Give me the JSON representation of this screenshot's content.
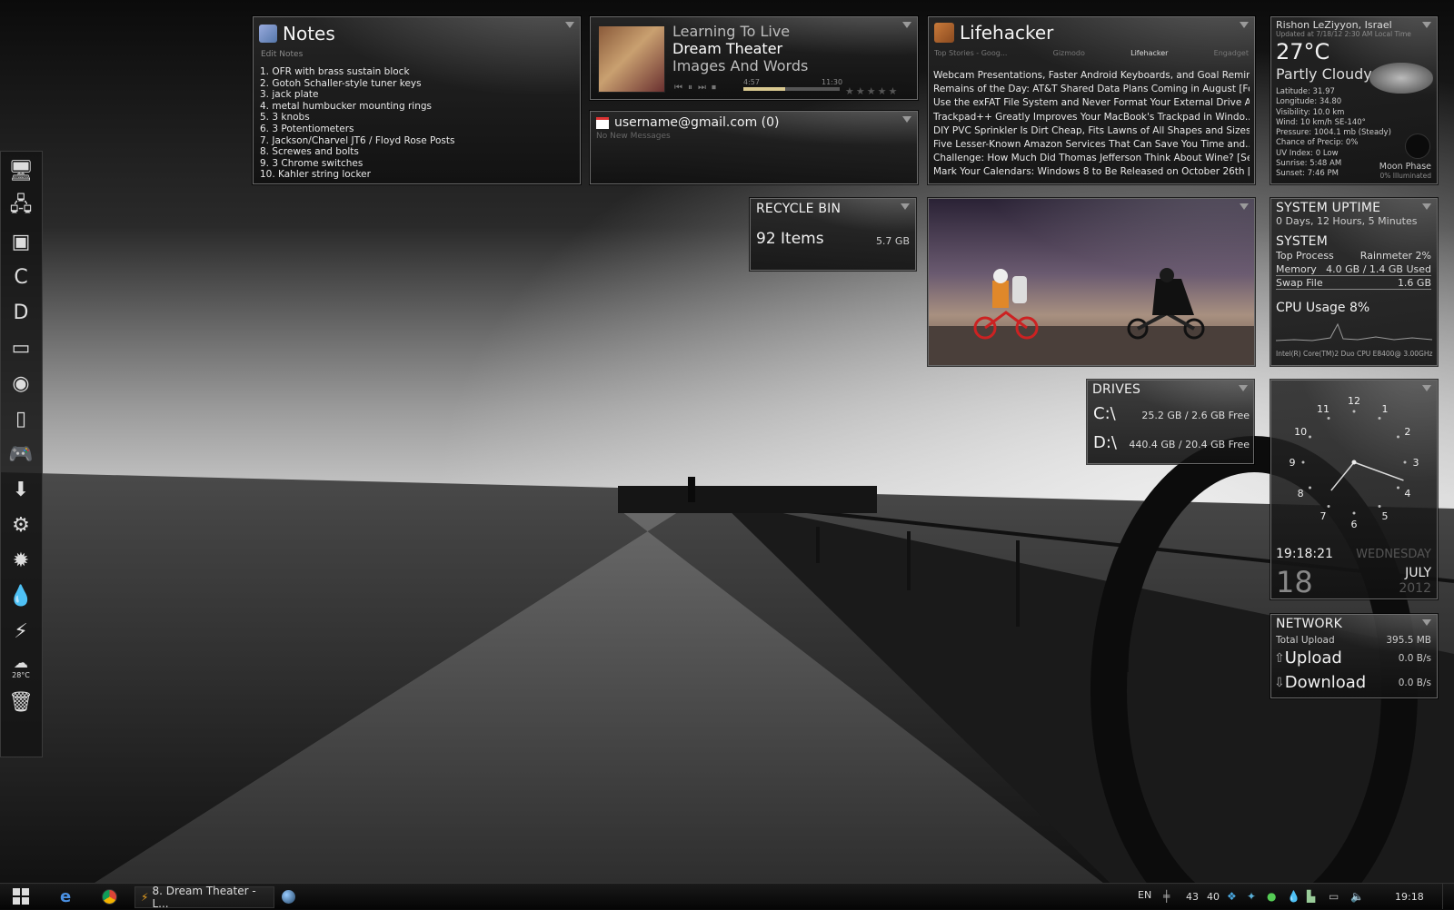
{
  "notes": {
    "title": "Notes",
    "subtitle": "Edit Notes",
    "items": [
      "1. OFR with brass sustain block",
      "2. Gotoh Schaller-style tuner keys",
      "3. jack plate",
      "4. metal humbucker mounting rings",
      "5. 3 knobs",
      "6. 3 Potentiometers",
      "7. Jackson/Charvel JT6 / Floyd Rose Posts",
      "8. Screwes and bolts",
      "9. 3 Chrome switches",
      "10. Kahler string locker"
    ]
  },
  "player": {
    "track": "Learning To Live",
    "artist": "Dream Theater",
    "album": "Images And Words",
    "elapsed": "4:57",
    "total": "11:30",
    "progress": 0.43
  },
  "gmail": {
    "account": "username@gmail.com (0)",
    "status": "No New Messages"
  },
  "recycle": {
    "title": "RECYCLE BIN",
    "items": "92 Items",
    "size": "5.7 GB"
  },
  "lifehacker": {
    "title": "Lifehacker",
    "tabs": [
      "Top Stories - Goog...",
      "Gizmodo",
      "Lifehacker",
      "Engadget"
    ],
    "headlines": [
      "Webcam Presentations, Faster Android Keyboards, and Goal Remin...",
      "Remains of the Day: AT&T Shared Data Plans Coming in August [For...",
      "Use the exFAT File System and Never Format Your External Drive Ag...",
      "Trackpad++ Greatly Improves Your MacBook's Trackpad in Windo...",
      "DIY PVC Sprinkler Is Dirt Cheap, Fits Lawns of All Shapes and Sizes...",
      "Five Lesser-Known Amazon Services That Can Save You Time and...",
      "Challenge: How Much Did Thomas Jefferson Think About Wine? [Se...",
      "Mark Your Calendars: Windows 8 to Be Released on October 26th [I..."
    ]
  },
  "weather": {
    "location": "Rishon LeZiyyon, Israel",
    "updated": "Updated at 7/18/12 2:30 AM Local Time",
    "temp": "27°C",
    "condition": "Partly Cloudy",
    "details": [
      "Latitude: 31.97",
      "Longitude: 34.80",
      "Visibility: 10.0 km",
      "Wind: 10 km/h SE-140°",
      "Pressure: 1004.1 mb (Steady)",
      "Chance of Precip: 0%",
      "UV Index: 0 Low",
      "Sunrise: 5:48 AM",
      "Sunset: 7:46 PM"
    ],
    "moon_label": "Moon Phase",
    "moon_value": "0% Illuminated"
  },
  "system": {
    "uptime_title": "SYSTEM UPTIME",
    "uptime": "0 Days, 12 Hours, 5 Minutes",
    "title": "SYSTEM",
    "top_process_label": "Top Process",
    "top_process_value": "Rainmeter 2%",
    "memory_label": "Memory",
    "memory_value": "4.0 GB / 1.4 GB Used",
    "swap_label": "Swap File",
    "swap_value": "1.6 GB",
    "cpu": "CPU Usage 8%",
    "cpu_model": "Intel(R) Core(TM)2 Duo CPU E8400@ 3.00GHz"
  },
  "drives": {
    "title": "DRIVES",
    "list": [
      {
        "letter": "C:\\",
        "info": "25.2 GB / 2.6 GB Free"
      },
      {
        "letter": "D:\\",
        "info": "440.4 GB / 20.4 GB Free"
      }
    ]
  },
  "clock": {
    "numbers": [
      "12",
      "1",
      "2",
      "3",
      "4",
      "5",
      "6",
      "7",
      "8",
      "9",
      "10",
      "11"
    ],
    "time": "19:18:21",
    "weekday": "WEDNESDAY",
    "day": "18",
    "month": "JULY",
    "year": "2012"
  },
  "network": {
    "title": "NETWORK",
    "total_label": "Total Upload",
    "total_value": "395.5 MB",
    "upload_label": "Upload",
    "upload_value": "0.0 B/s",
    "download_label": "Download",
    "download_value": "0.0 B/s"
  },
  "dock": {
    "icons": [
      "computer-icon",
      "network-icon",
      "media-icon",
      "ccleaner-icon",
      "daemon-tools-icon",
      "screen-icon",
      "audio-icon",
      "phone-icon",
      "gamepad-icon",
      "download-icon",
      "settings-icon",
      "gear-icon",
      "droplet-icon",
      "winamp-icon",
      "weather-icon",
      "recycle-bin-icon"
    ],
    "weather_temp": "28°C"
  },
  "taskbar": {
    "active_window": "8. Dream Theater - L...",
    "lang": "EN",
    "tray_nums": [
      "43",
      "40"
    ],
    "clock": "19:18"
  }
}
